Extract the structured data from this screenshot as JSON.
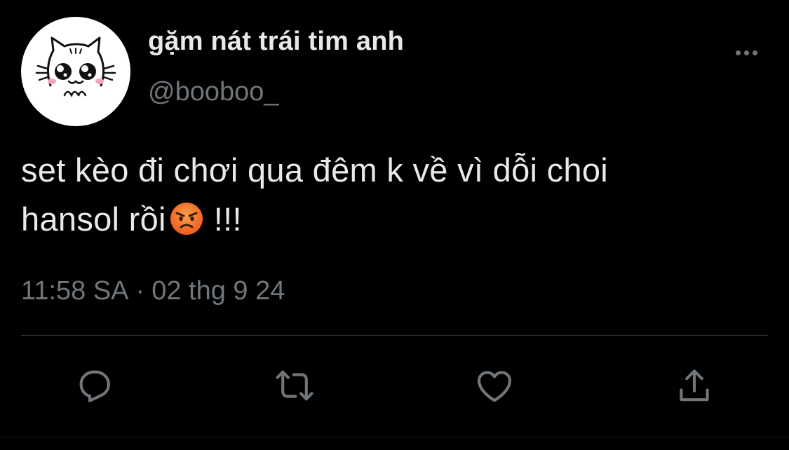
{
  "tweet": {
    "author": {
      "display_name": "gặm nát trái tim anh",
      "handle": "@booboo_",
      "avatar_icon": "cat-face-avatar"
    },
    "text_lines": [
      "set kèo đi chơi qua đêm k về vì dỗi choi",
      "hansol rồi"
    ],
    "text_suffix": "!!!",
    "emoji": "angry-face-emoji",
    "timestamp": {
      "time": "11:58 SA",
      "separator": "·",
      "date": "02 thg 9 24"
    },
    "actions": [
      "reply-icon",
      "retweet-icon",
      "like-icon",
      "share-icon"
    ]
  },
  "colors": {
    "background": "#000000",
    "primary_text": "#e7e9ea",
    "secondary_text": "#71767b",
    "divider": "#2f3336",
    "emoji_face": "#f5812a"
  }
}
